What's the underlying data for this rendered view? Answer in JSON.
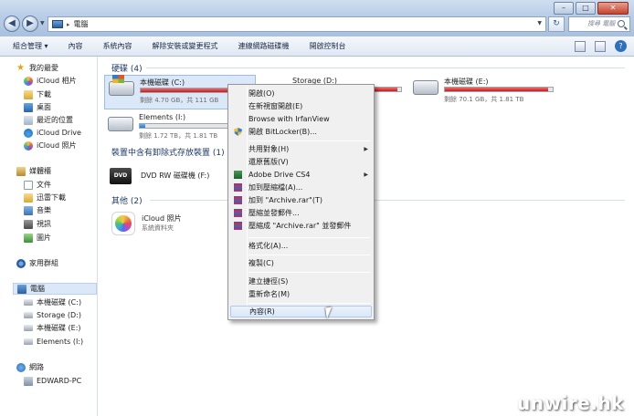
{
  "window": {
    "controls": {
      "minimize": "–",
      "maximize": "□",
      "close": "✕"
    }
  },
  "nav": {
    "back": "◀",
    "forward": "▶",
    "dropdown": "▼",
    "address_separator": "▸",
    "address_text": "電腦",
    "address_arrow": "▼",
    "refresh": "↻",
    "search_placeholder": "搜尋 電腦"
  },
  "command_bar": {
    "items": [
      "組合管理 ▾",
      "內容",
      "系統內容",
      "解除安裝或變更程式",
      "連線網路磁碟機",
      "開啟控制台"
    ],
    "help": "?"
  },
  "sidebar": {
    "favorites_title": "我的最愛",
    "favorites": [
      "iCloud 相片",
      "下載",
      "桌面",
      "最近的位置",
      "iCloud Drive",
      "iCloud 照片"
    ],
    "libraries_title": "媒體櫃",
    "libraries": [
      "文件",
      "迅雷下載",
      "音樂",
      "視訊",
      "圖片"
    ],
    "homegroup": "家用群組",
    "computer_title": "電腦",
    "computer": [
      "本機磁碟 (C:)",
      "Storage (D:)",
      "本機磁碟 (E:)",
      "Elements (I:)"
    ],
    "network_title": "網路",
    "network": [
      "EDWARD-PC"
    ]
  },
  "main": {
    "hard_disks_header": "硬碟 (4)",
    "removable_header": "裝置中含有卸除式存放裝置 (1)",
    "other_header": "其他 (2)",
    "drives": [
      {
        "name": "本機磁碟 (C:)",
        "free": "剩餘 4.70 GB，共 111 GB",
        "used_pct": 96,
        "color": "#c81a1a"
      },
      {
        "name": "Storage (D:)",
        "free": "",
        "used_pct": 97,
        "color": "#c81a1a"
      },
      {
        "name": "本機磁碟 (E:)",
        "free": "剩餘 70.1 GB，共 1.81 TB",
        "used_pct": 96,
        "color": "#c81a1a"
      },
      {
        "name": "Elements (I:)",
        "free": "剩餘 1.72 TB，共 1.81 TB",
        "used_pct": 5,
        "color": "#1f7ed4"
      }
    ],
    "dvd": {
      "name": "DVD RW 磁碟機 (F:)",
      "label": "DVD"
    },
    "icloud_photos": {
      "name": "iCloud 照片",
      "subtitle": "系統資料夾"
    }
  },
  "context_menu": {
    "items": [
      {
        "label": "開啟(O)"
      },
      {
        "label": "在新視窗開啟(E)"
      },
      {
        "label": "Browse with IrfanView"
      },
      {
        "label": "開啟 BitLocker(B)...",
        "icon": "shield"
      },
      {
        "label": "共用對象(H)",
        "submenu": true
      },
      {
        "label": "還原舊版(V)"
      },
      {
        "label": "Adobe Drive CS4",
        "submenu": true,
        "icon": "adobe"
      },
      {
        "label": "加到壓縮檔(A)...",
        "icon": "rar"
      },
      {
        "label": "加到 \"Archive.rar\"(T)",
        "icon": "rar"
      },
      {
        "label": "壓縮並發郵件...",
        "icon": "rar"
      },
      {
        "label": "壓縮成 \"Archive.rar\" 並發郵件",
        "icon": "rar"
      },
      {
        "label": "格式化(A)..."
      },
      {
        "label": "複製(C)"
      },
      {
        "label": "建立捷徑(S)"
      },
      {
        "label": "重新命名(M)"
      },
      {
        "label": "內容(R)"
      }
    ],
    "submenu_arrow": "▶"
  },
  "watermark": "unwire.hk"
}
